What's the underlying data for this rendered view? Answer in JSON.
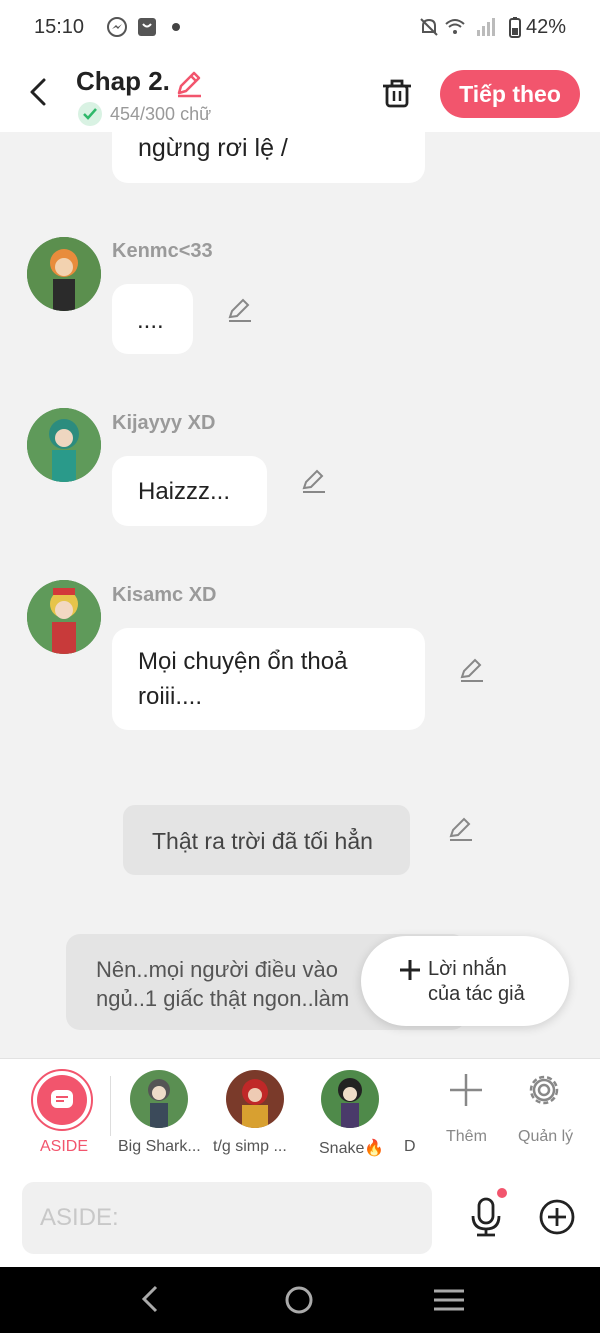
{
  "status": {
    "time": "15:10",
    "battery": "42%"
  },
  "header": {
    "title": "Chap 2.",
    "word_count": "454/300 chữ",
    "next_label": "Tiếp theo"
  },
  "messages": {
    "partial_text": "ngừng rơi lệ /",
    "m1": {
      "name": "Kenmc<33",
      "text": "...."
    },
    "m2": {
      "name": "Kijayyy XD",
      "text": "Haizzz..."
    },
    "m3": {
      "name": "Kisamc XD",
      "line1": "Mọi chuyện ổn thoả",
      "line2": "roiii...."
    },
    "narration": "Thật ra trời đã tối hẳn",
    "aside_line1": "Nên..mọi người điều vào",
    "aside_line2": "ngủ..1 giấc thật ngon..làm"
  },
  "float_button": {
    "line1": "Lời nhắn",
    "line2": "của tác giả"
  },
  "characters": {
    "aside": "ASIDE",
    "c1": "Big Shark...",
    "c2": "t/g simp ...",
    "c3": "Snake🔥",
    "c4": "D",
    "add": "Thêm",
    "manage": "Quản lý"
  },
  "input": {
    "placeholder": "ASIDE:"
  },
  "colors": {
    "accent": "#f2556d",
    "bubble": "#ffffff",
    "background": "#f2f2f2"
  }
}
